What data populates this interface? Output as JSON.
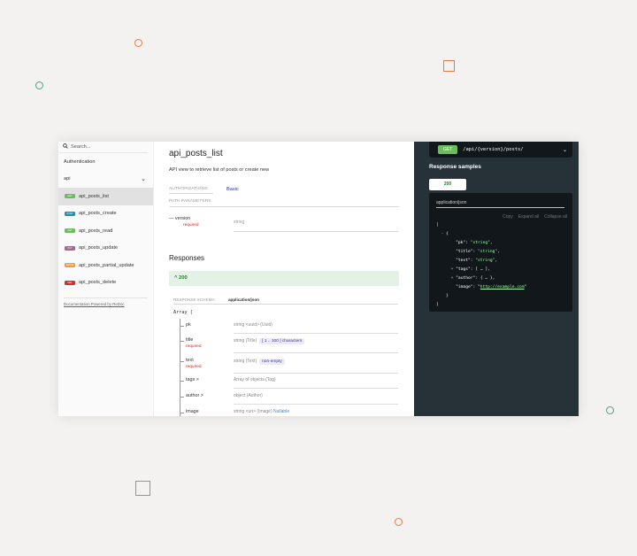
{
  "sidebar": {
    "search_placeholder": "Search...",
    "items": [
      {
        "label": "Authentication"
      },
      {
        "label": "api"
      }
    ],
    "operations": [
      {
        "method": "GET",
        "label": "api_posts_list",
        "color": "#6bbd5b",
        "active": true
      },
      {
        "method": "POST",
        "label": "api_posts_create",
        "color": "#248fb2",
        "active": false
      },
      {
        "method": "GET",
        "label": "api_posts_read",
        "color": "#6bbd5b",
        "active": false
      },
      {
        "method": "PUT",
        "label": "api_posts_update",
        "color": "#9b708b",
        "active": false
      },
      {
        "method": "PATCH",
        "label": "api_posts_partial_update",
        "color": "#e5a344",
        "active": false
      },
      {
        "method": "DEL",
        "label": "api_posts_delete",
        "color": "#cc3333",
        "active": false
      }
    ],
    "footer_link": "Documentation Powered by ReDoc"
  },
  "main": {
    "title": "api_posts_list",
    "description": "API view to retrieve list of posts or create new",
    "authorizations_label": "AUTHORIZATIONS:",
    "authorizations_value": "Basic",
    "path_parameters_label": "PATH PARAMETERS",
    "param": {
      "name": "version",
      "required": "required",
      "type": "string"
    },
    "responses_heading": "Responses",
    "response_code": "^ 200",
    "schema_label": "RESPONSE SCHEMA:",
    "schema_type": "application/json",
    "array_open": "Array [",
    "fields": [
      {
        "name": "pk",
        "required": "",
        "type": "string <uuid> (Uuid)",
        "constraint": "",
        "nullable": ""
      },
      {
        "name": "title",
        "required": "required",
        "type": "string (Title)",
        "constraint": "[ 1 .. 100 ] characters",
        "nullable": ""
      },
      {
        "name": "text",
        "required": "required",
        "type": "string (Text)",
        "constraint": "non-empty",
        "nullable": ""
      },
      {
        "name": "tags >",
        "required": "",
        "type": "Array of objects (Tag)",
        "constraint": "",
        "nullable": ""
      },
      {
        "name": "author >",
        "required": "",
        "type": "object (Author)",
        "constraint": "",
        "nullable": ""
      },
      {
        "name": "image",
        "required": "",
        "type": "string <uri> (Image)",
        "constraint": "",
        "nullable": "Nullable"
      }
    ]
  },
  "right": {
    "method": "GET",
    "path": "/api/{version}/posts/",
    "samples_heading": "Response samples",
    "tab_label": "200",
    "content_type": "application/json",
    "actions": [
      "Copy",
      "Expand all",
      "Collapse all"
    ]
  },
  "colors": {
    "accent": "#32329f",
    "success": "#1d8127",
    "required": "#d41f1c",
    "dark_panel": "#263238",
    "deco": "#e07b4a",
    "deco_green": "#4aa37a"
  }
}
